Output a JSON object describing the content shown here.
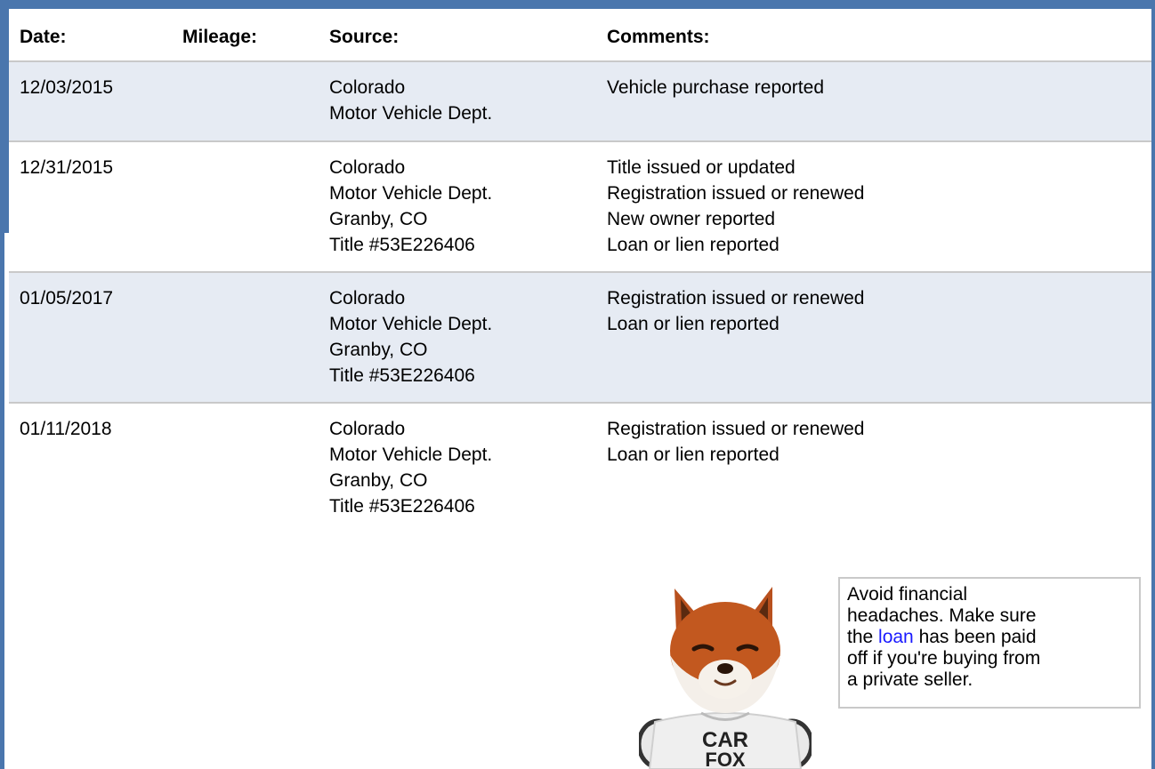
{
  "columns": {
    "date": "Date:",
    "mileage": "Mileage:",
    "source": "Source:",
    "comments": "Comments:"
  },
  "records": [
    {
      "date": "12/03/2015",
      "mileage": "",
      "source": [
        "Colorado",
        "Motor Vehicle Dept."
      ],
      "comments": [
        "Vehicle purchase reported"
      ]
    },
    {
      "date": "12/31/2015",
      "mileage": "",
      "source": [
        "Colorado",
        "Motor Vehicle Dept.",
        "Granby, CO",
        "Title #53E226406"
      ],
      "comments": [
        "Title issued or updated",
        "Registration issued or renewed",
        "New owner reported",
        "Loan or lien reported"
      ]
    },
    {
      "date": "01/05/2017",
      "mileage": "",
      "source": [
        "Colorado",
        "Motor Vehicle Dept.",
        "Granby, CO",
        "Title #53E226406"
      ],
      "comments": [
        "Registration issued or renewed",
        "Loan or lien reported"
      ]
    },
    {
      "date": "01/11/2018",
      "mileage": "",
      "source": [
        "Colorado",
        "Motor Vehicle Dept.",
        "Granby, CO",
        "Title #53E226406"
      ],
      "comments": [
        "Registration issued or renewed",
        "Loan or lien reported"
      ]
    }
  ],
  "tip": {
    "line1": "Avoid financial",
    "line2": "headaches. Make sure",
    "line3_pre": "the ",
    "line3_link": "loan",
    "line3_post": " has been paid",
    "line4": "off if you're buying from",
    "line5": "a private seller."
  },
  "mascot": {
    "shirt_line1": "CAR",
    "shirt_line2": "FOX"
  },
  "colors": {
    "frame": "#4a76ad",
    "row_shade": "#e6ebf3",
    "divider": "#c9c9c9",
    "link": "#1a1aff"
  }
}
